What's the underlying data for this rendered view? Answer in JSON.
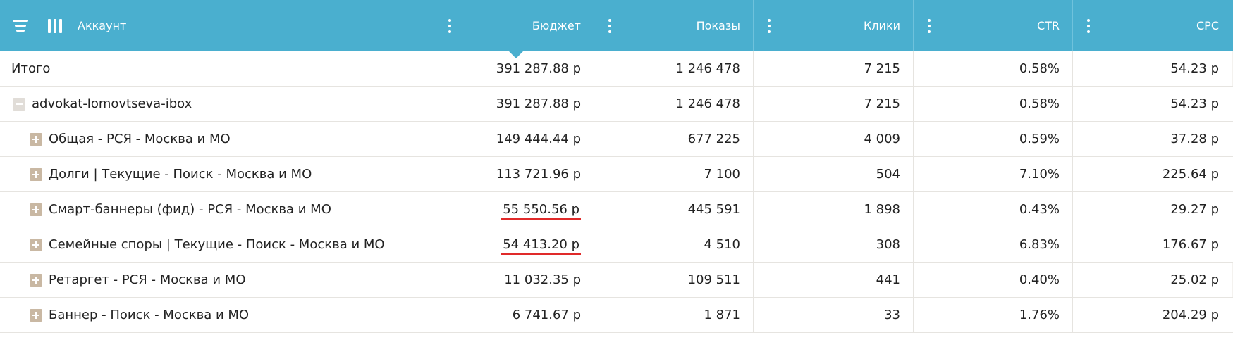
{
  "header": {
    "account_label": "Аккаунт",
    "columns": [
      "Бюджет",
      "Показы",
      "Клики",
      "CTR",
      "CPC"
    ]
  },
  "rows": [
    {
      "name": "Итого",
      "values": [
        "391 287.88 р",
        "1 246 478",
        "7 215",
        "0.58%",
        "54.23 р"
      ]
    },
    {
      "name": "advokat-lomovtseva-ibox",
      "values": [
        "391 287.88 р",
        "1 246 478",
        "7 215",
        "0.58%",
        "54.23 р"
      ]
    },
    {
      "name": "Общая - РСЯ - Москва и МО",
      "values": [
        "149 444.44 р",
        "677 225",
        "4 009",
        "0.59%",
        "37.28 р"
      ]
    },
    {
      "name": "Долги | Текущие - Поиск - Москва и МО",
      "values": [
        "113 721.96 р",
        "7 100",
        "504",
        "7.10%",
        "225.64 р"
      ]
    },
    {
      "name": "Смарт-баннеры (фид) - РСЯ - Москва и МО",
      "values": [
        "55 550.56 р",
        "445 591",
        "1 898",
        "0.43%",
        "29.27 р"
      ]
    },
    {
      "name": "Семейные споры | Текущие - Поиск - Москва и МО",
      "values": [
        "54 413.20 р",
        "4 510",
        "308",
        "6.83%",
        "176.67 р"
      ]
    },
    {
      "name": "Ретаргет - РСЯ - Москва и МО",
      "values": [
        "11 032.35 р",
        "109 511",
        "441",
        "0.40%",
        "25.02 р"
      ]
    },
    {
      "name": "Баннер - Поиск - Москва и МО",
      "values": [
        "6 741.67 р",
        "1 871",
        "33",
        "1.76%",
        "204.29 р"
      ]
    }
  ],
  "colors": {
    "header_bg": "#4aafcf",
    "row_shaded": "#f4f2ef",
    "underline": "#e02a2a",
    "expand_icon": "#c9b8a3"
  }
}
